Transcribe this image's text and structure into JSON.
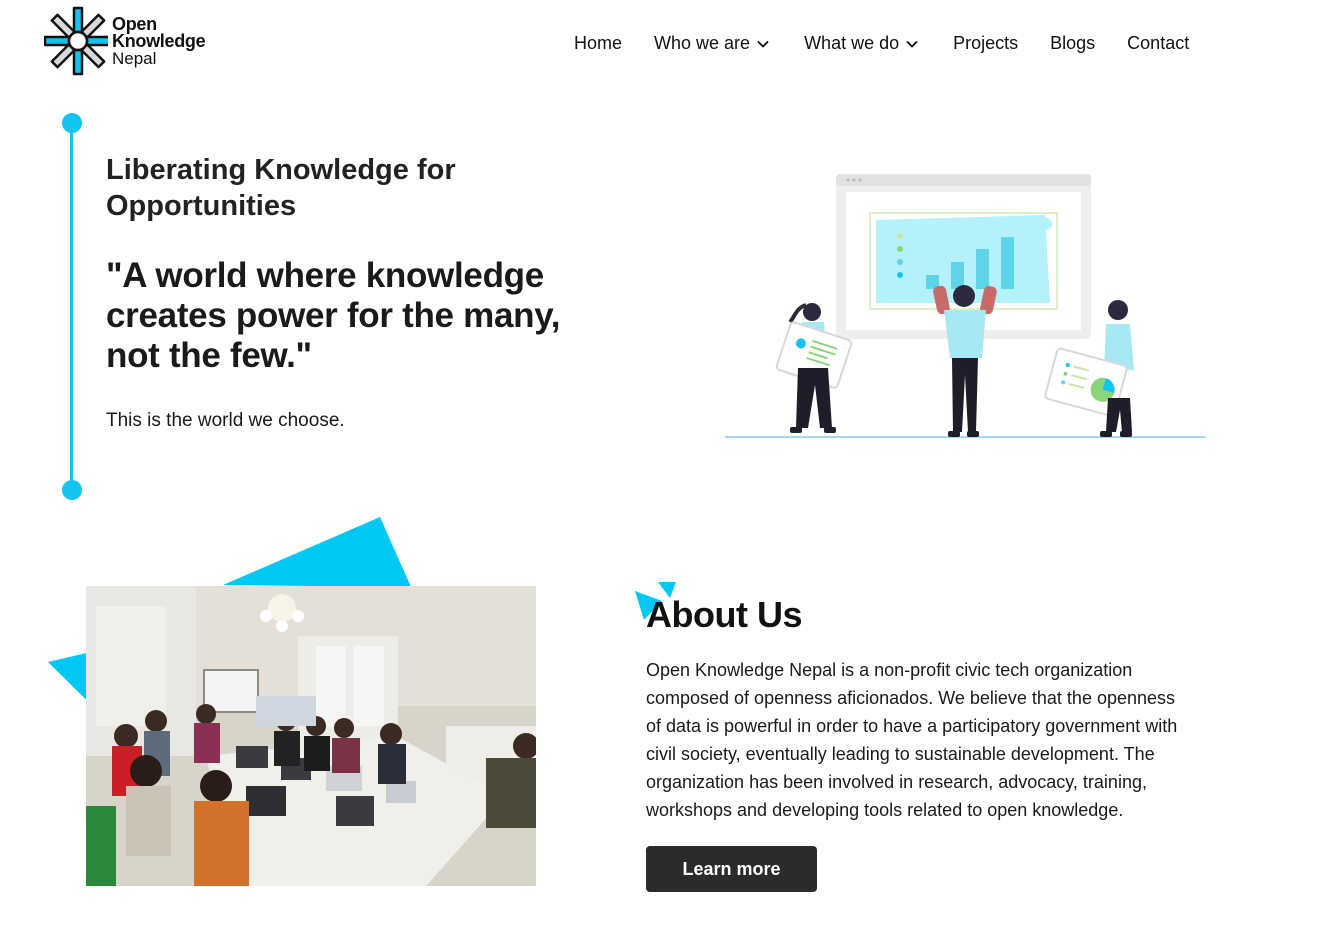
{
  "brand": {
    "line1": "Open",
    "line2": "Knowledge",
    "line3": "Nepal",
    "accent_color": "#12c4f0",
    "dark_color": "#1a1a1a"
  },
  "nav": {
    "items": [
      {
        "label": "Home",
        "has_dropdown": false
      },
      {
        "label": "Who we are",
        "has_dropdown": true
      },
      {
        "label": "What we do",
        "has_dropdown": true
      },
      {
        "label": "Projects",
        "has_dropdown": false
      },
      {
        "label": "Blogs",
        "has_dropdown": false
      },
      {
        "label": "Contact",
        "has_dropdown": false
      }
    ]
  },
  "hero": {
    "subtitle": "Liberating Knowledge for Opportunities",
    "quote": "\"A world where knowledge creates power for the many, not the few.\"",
    "tagline": "This is the world we choose."
  },
  "about": {
    "title": "About Us",
    "body": "Open Knowledge Nepal is a non-profit civic tech organization composed of openness aficionados. We believe that the openness of data is powerful in order to have a participatory government with civil society, eventually leading to sustainable development. The organization has been involved in research, advocacy, training, workshops and developing tools related to open knowledge.",
    "button_label": "Learn more"
  }
}
